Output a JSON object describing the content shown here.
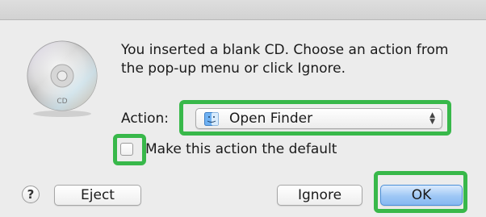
{
  "dialog": {
    "message": "You inserted a blank CD. Choose an action from the pop-up menu or click Ignore.",
    "cd_icon_text": "CD"
  },
  "action": {
    "label": "Action:",
    "selected_value": "Open Finder",
    "selected_icon": "finder-icon"
  },
  "default_checkbox": {
    "label": "Make this action the default",
    "checked": false
  },
  "buttons": {
    "help": "?",
    "eject": "Eject",
    "ignore": "Ignore",
    "ok": "OK"
  },
  "colors": {
    "highlight": "#38b84a",
    "default_button": "#9ec7f5",
    "background": "#ececec"
  }
}
